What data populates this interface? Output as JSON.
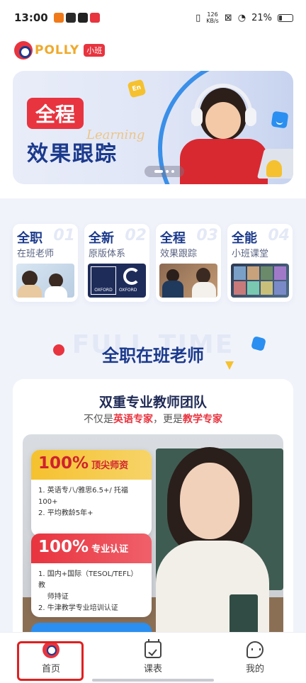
{
  "status_bar": {
    "time": "13:00",
    "speed_value": "126",
    "speed_unit": "KB/s",
    "battery": "21%"
  },
  "header": {
    "logo_text": "POLLY",
    "logo_badge": "小班"
  },
  "banner": {
    "tag": "全程",
    "subtitle": "效果跟踪",
    "script_word": "Learning",
    "badge": "En",
    "active_slide": 1,
    "slide_count": 3
  },
  "features": [
    {
      "title": "全职",
      "subtitle": "在班老师",
      "number": "01"
    },
    {
      "title": "全新",
      "subtitle": "原版体系",
      "number": "02",
      "logo_text": "OXFORD"
    },
    {
      "title": "全程",
      "subtitle": "效果跟踪",
      "number": "03"
    },
    {
      "title": "全能",
      "subtitle": "小班课堂",
      "number": "04"
    }
  ],
  "section": {
    "bg_word": "FULL TIME",
    "title": "全职在班老师"
  },
  "team": {
    "title": "双重专业教师团队",
    "sub_prefix": "不仅是",
    "sub_red1": "英语专家",
    "sub_mid": "，更是",
    "sub_red2": "教学专家",
    "box1": {
      "percent": "100%",
      "label": "顶尖师资",
      "items": [
        "1. 英语专八/雅思6.5+/ 托福100+",
        "2. 平均教龄5年+"
      ]
    },
    "box2": {
      "percent": "100%",
      "label": "专业认证",
      "items": [
        "1. 国内+国际（TESOL/TEFL）教",
        "    师持证",
        "2. 牛津教学专业培训认证"
      ]
    }
  },
  "tabbar": {
    "tabs": [
      {
        "label": "首页",
        "icon": "polly-home-icon",
        "active": true
      },
      {
        "label": "课表",
        "icon": "calendar-check-icon"
      },
      {
        "label": "我的",
        "icon": "profile-chat-icon"
      }
    ]
  },
  "colors": {
    "brand_blue": "#1b3a8c",
    "brand_red": "#e8343f",
    "accent_yellow": "#f5c12e",
    "accent_blue": "#2a8ff0",
    "highlight_red": "#e02020"
  }
}
